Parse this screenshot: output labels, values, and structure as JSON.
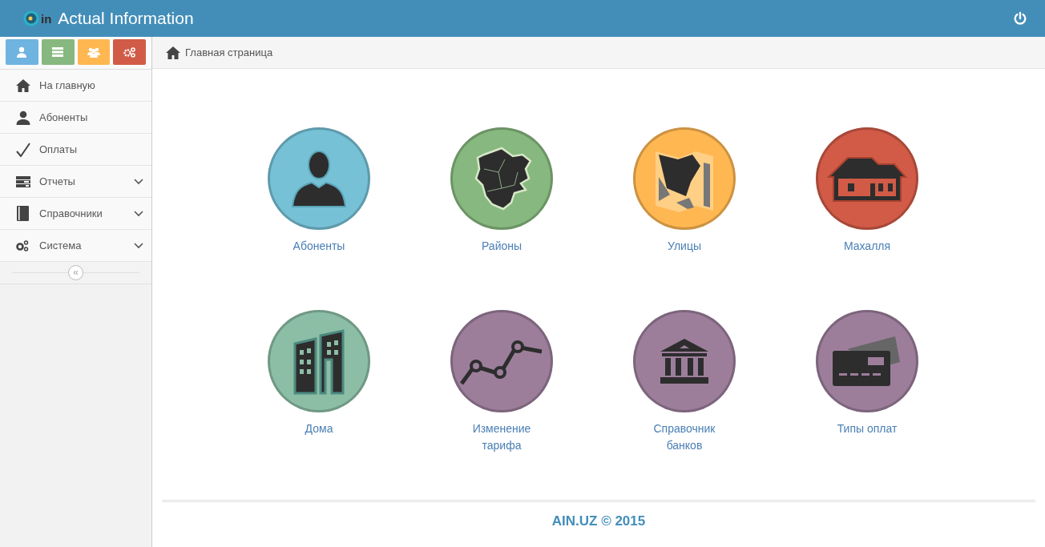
{
  "header": {
    "logo_text": "in",
    "title": "Actual Information"
  },
  "shortcuts": [
    {
      "color": "#6fb3e0"
    },
    {
      "color": "#87b87f"
    },
    {
      "color": "#ffb752"
    },
    {
      "color": "#d15b47"
    }
  ],
  "sidebar": {
    "items": [
      {
        "label": "На главную",
        "kind": "link"
      },
      {
        "label": "Абоненты",
        "kind": "link"
      },
      {
        "label": "Оплаты",
        "kind": "link"
      },
      {
        "label": "Отчеты",
        "kind": "submenu"
      },
      {
        "label": "Справочники",
        "kind": "submenu"
      },
      {
        "label": "Система",
        "kind": "submenu"
      }
    ],
    "collapse_glyph": "«"
  },
  "breadcrumb": {
    "label": "Главная страница"
  },
  "tiles": [
    {
      "label": "Абоненты",
      "color": "#76c1d6",
      "kind": "person"
    },
    {
      "label": "Районы",
      "color": "#87b87f",
      "kind": "map"
    },
    {
      "label": "Улицы",
      "color": "#ffb752",
      "kind": "streets"
    },
    {
      "label": "Махалля",
      "color": "#d15b47",
      "kind": "house"
    },
    {
      "label": "Дома",
      "color": "#8cbea6",
      "kind": "buildings"
    },
    {
      "label": "Изменение тарифа",
      "color": "#9c7e9b",
      "kind": "chart"
    },
    {
      "label": "Справочник банков",
      "color": "#9c7e9b",
      "kind": "bank"
    },
    {
      "label": "Типы оплат",
      "color": "#9c7e9b",
      "kind": "card"
    }
  ],
  "footer": {
    "text": "AIN.UZ © 2015"
  }
}
